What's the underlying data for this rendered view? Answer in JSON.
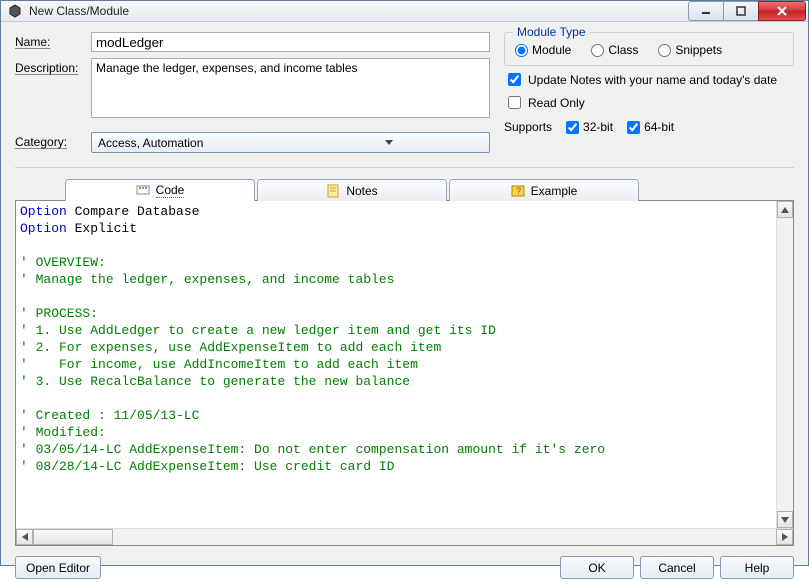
{
  "window": {
    "title": "New Class/Module"
  },
  "labels": {
    "name": "Name:",
    "description": "Description:",
    "category": "Category:",
    "moduleType": "Module Type",
    "supports": "Supports"
  },
  "fields": {
    "name": "modLedger",
    "description": "Manage the ledger, expenses, and income tables",
    "category": "Access, Automation"
  },
  "moduleType": {
    "options": {
      "module": "Module",
      "class": "Class",
      "snippets": "Snippets"
    },
    "selected": "module"
  },
  "checkboxes": {
    "updateNotes": {
      "label": "Update Notes with your name and today's date",
      "checked": true
    },
    "readOnly": {
      "label": "Read Only",
      "checked": false
    },
    "bit32": {
      "label": "32-bit",
      "checked": true
    },
    "bit64": {
      "label": "64-bit",
      "checked": true
    }
  },
  "tabs": {
    "code": "Code",
    "notes": "Notes",
    "example": "Example",
    "active": "code"
  },
  "code": {
    "lines": [
      {
        "t": "kw",
        "s": "Option"
      },
      {
        "t": "p",
        "s": " Compare Database\n"
      },
      {
        "t": "kw",
        "s": "Option"
      },
      {
        "t": "p",
        "s": " Explicit\n"
      },
      {
        "t": "p",
        "s": "\n"
      },
      {
        "t": "cmt",
        "s": "' OVERVIEW:\n"
      },
      {
        "t": "cmt",
        "s": "' Manage the ledger, expenses, and income tables\n"
      },
      {
        "t": "p",
        "s": "\n"
      },
      {
        "t": "cmt",
        "s": "' PROCESS:\n"
      },
      {
        "t": "cmt",
        "s": "' 1. Use AddLedger to create a new ledger item and get its ID\n"
      },
      {
        "t": "cmt",
        "s": "' 2. For expenses, use AddExpenseItem to add each item\n"
      },
      {
        "t": "cmt",
        "s": "'    For income, use AddIncomeItem to add each item\n"
      },
      {
        "t": "cmt",
        "s": "' 3. Use RecalcBalance to generate the new balance\n"
      },
      {
        "t": "p",
        "s": "\n"
      },
      {
        "t": "cmt",
        "s": "' Created : 11/05/13-LC\n"
      },
      {
        "t": "cmt",
        "s": "' Modified:\n"
      },
      {
        "t": "cmt",
        "s": "' 03/05/14-LC AddExpenseItem: Do not enter compensation amount if it's zero\n"
      },
      {
        "t": "cmt",
        "s": "' 08/28/14-LC AddExpenseItem: Use credit card ID\n"
      }
    ]
  },
  "buttons": {
    "openEditor": "Open Editor",
    "ok": "OK",
    "cancel": "Cancel",
    "help": "Help"
  }
}
